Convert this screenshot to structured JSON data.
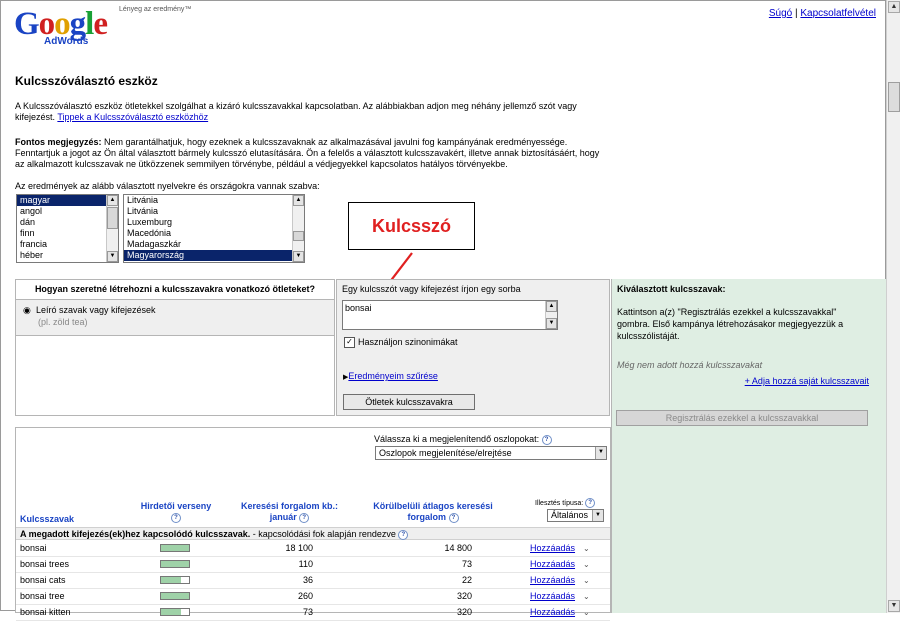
{
  "header": {
    "logo_text": "Google",
    "logo_sub": "AdWords",
    "tagline": "Lényeg az eredmény™",
    "help_link": "Súgó",
    "separator": "|",
    "contact_link": "Kapcsolatfelvétel"
  },
  "page": {
    "title": "Kulcsszóválasztó eszköz",
    "intro_line1": "A Kulcsszóválasztó eszköz ötletekkel szolgálhat a kizáró kulcsszavakkal kapcsolatban. Az alábbiakban adjon meg néhány jellemző szót vagy",
    "intro_line2_prefix": "kifejezést.",
    "intro_link": "Tippek a Kulcsszóválasztó eszközhöz",
    "note_bold": "Fontos megjegyzés:",
    "note_line1": " Nem garantálhatjuk, hogy ezeknek a kulcsszavaknak az alkalmazásával javulni fog kampányának eredményessége.",
    "note_line2": "Fenntartjuk a jogot az Ön által választott bármely kulcsszó elutasítására. Ön a felelős a választott kulcsszavakért, illetve annak biztosításáért, hogy",
    "note_line3": "az alkalmazott kulcsszavak ne ütközzenek semmilyen törvénybe, például a védjegyekkel kapcsolatos hatályos törvényekbe.",
    "lang_label": "Az eredmények az alább választott nyelvekre és országokra vannak szabva:"
  },
  "languages": [
    "magyar",
    "angol",
    "dán",
    "finn",
    "francia",
    "héber"
  ],
  "countries": [
    "Litvánia",
    "Litvánia",
    "Luxemburg",
    "Macedónia",
    "Madagaszkár",
    "Magyarország"
  ],
  "callout": {
    "text": "Kulcsszó",
    "color": "#e02020"
  },
  "left_panel": {
    "heading": "Hogyan szeretné létrehozni a kulcsszavakra vonatkozó ötleteket?",
    "option_label": "Leíró szavak vagy kifejezések",
    "option_hint": "(pl. zöld tea)"
  },
  "mid_panel": {
    "heading": "Egy kulcsszót vagy kifejezést írjon egy sorba",
    "input_value": "bonsai",
    "synonyms_label": "Használjon szinonimákat",
    "filter_link": "Eredményeim szűrése",
    "submit_label": "Ötletek kulcsszavakra"
  },
  "right_panel": {
    "heading": "Kiválasztott kulcsszavak:",
    "instructions": "Kattintson a(z) \"Regisztrálás ezekkel a kulcsszavakkal\" gombra. Első kampánya létrehozásakor megjegyezzük a kulcsszólistáját.",
    "empty_text": "Még nem adott hozzá kulcsszavakat",
    "add_own_link": "+ Adja hozzá saját kulcsszavait",
    "register_button": "Regisztrálás ezekkel a kulcsszavakkal"
  },
  "results": {
    "columns_label": "Válassza ki a megjelenítendő oszlopokat:",
    "columns_select": "Oszlopok megjelenítése/elrejtése",
    "match_type_label": "Illesztés típusa:",
    "match_type_value": "Általános",
    "col_keywords": "Kulcsszavak",
    "col_competition": "Hirdetői verseny",
    "col_search_volume": "Keresési forgalom kb.: január",
    "col_avg_volume": "Körülbelüli átlagos keresési forgalom",
    "section_bold": "A megadott kifejezés(ek)hez kapcsolódó kulcsszavak.",
    "section_rest": " - kapcsolódási fok alapján rendezve",
    "add_label": "Hozzáadás",
    "rows": [
      {
        "keyword": "bonsai",
        "competition": 1.0,
        "volume": "18 100",
        "avg": "14 800"
      },
      {
        "keyword": "bonsai trees",
        "competition": 1.0,
        "volume": "110",
        "avg": "73"
      },
      {
        "keyword": "bonsai cats",
        "competition": 0.73,
        "volume": "36",
        "avg": "22"
      },
      {
        "keyword": "bonsai tree",
        "competition": 1.0,
        "volume": "260",
        "avg": "320"
      },
      {
        "keyword": "bonsai kitten",
        "competition": 0.73,
        "volume": "73",
        "avg": "320"
      }
    ]
  }
}
